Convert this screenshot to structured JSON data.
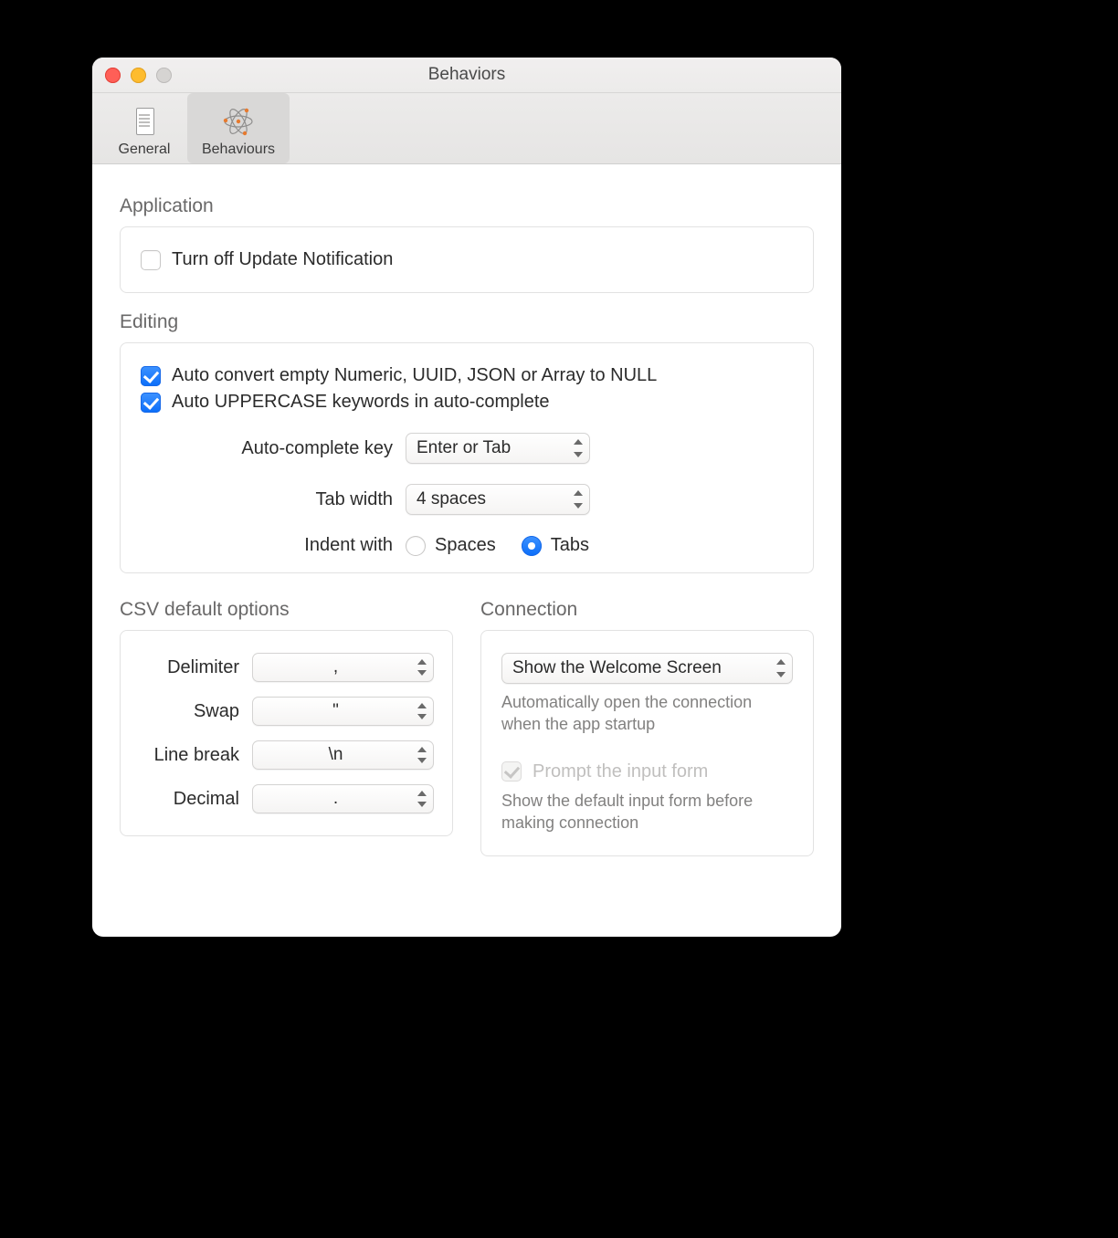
{
  "window": {
    "title": "Behaviors"
  },
  "toolbar": {
    "items": [
      {
        "label": "General"
      },
      {
        "label": "Behaviours"
      }
    ]
  },
  "sections": {
    "application": {
      "title": "Application",
      "update_notification_label": "Turn off Update Notification"
    },
    "editing": {
      "title": "Editing",
      "auto_null_label": "Auto convert empty Numeric, UUID, JSON or Array to NULL",
      "auto_upper_label": "Auto UPPERCASE keywords in auto-complete",
      "autocomplete_key_label": "Auto-complete key",
      "autocomplete_key_value": "Enter or Tab",
      "tab_width_label": "Tab width",
      "tab_width_value": "4 spaces",
      "indent_label": "Indent with",
      "indent_spaces": "Spaces",
      "indent_tabs": "Tabs"
    },
    "csv": {
      "title": "CSV default options",
      "delimiter_label": "Delimiter",
      "delimiter_value": ",",
      "swap_label": "Swap",
      "swap_value": "\"",
      "linebreak_label": "Line break",
      "linebreak_value": "\\n",
      "decimal_label": "Decimal",
      "decimal_value": "."
    },
    "connection": {
      "title": "Connection",
      "startup_value": "Show the Welcome Screen",
      "startup_hint": "Automatically open the connection when the app startup",
      "prompt_label": "Prompt the input form",
      "prompt_hint": "Show the default input form before making connection"
    }
  }
}
